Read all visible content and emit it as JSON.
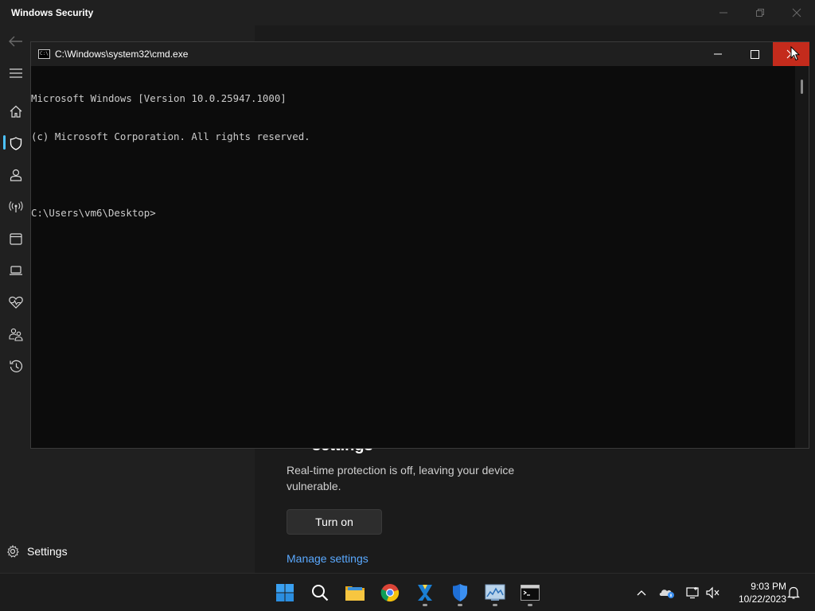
{
  "windows_security": {
    "title": "Windows Security",
    "nav": {
      "settings_label": "Settings"
    },
    "content": {
      "heading_fragment": "settings",
      "description": "Real-time protection is off, leaving your device vulnerable.",
      "turn_on_label": "Turn on",
      "manage_link": "Manage settings"
    }
  },
  "cmd": {
    "title": "C:\\Windows\\system32\\cmd.exe",
    "icon_text": "C:\\",
    "lines": [
      "Microsoft Windows [Version 10.0.25947.1000]",
      "(c) Microsoft Corporation. All rights reserved.",
      "",
      "C:\\Users\\vm6\\Desktop>"
    ]
  },
  "taskbar": {
    "apps": [
      "start-icon",
      "search-icon",
      "file-explorer-icon",
      "chrome-icon",
      "visual-studio-code-icon",
      "windows-security-icon",
      "resource-monitor-icon",
      "terminal-icon"
    ],
    "time": "9:03 PM",
    "date": "10/22/2023"
  },
  "colors": {
    "accent": "#4cc2ff",
    "close_hover": "#c42b1c",
    "link": "#5aa9ff"
  }
}
